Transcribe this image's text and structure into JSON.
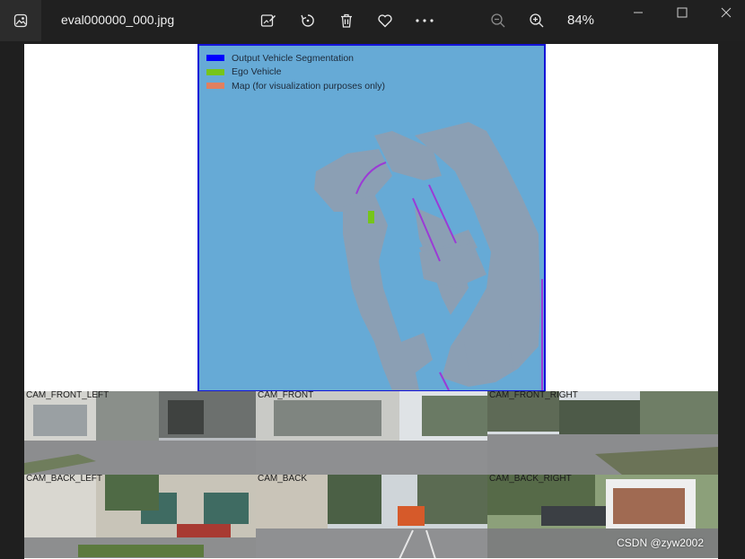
{
  "window": {
    "filename": "eval000000_000.jpg",
    "zoom_level": "84%"
  },
  "toolbar": {
    "icons": [
      "edit-image-icon",
      "rotate-icon",
      "delete-icon",
      "favorite-icon",
      "more-icon",
      "zoom-out-icon",
      "zoom-in-icon"
    ]
  },
  "bev": {
    "legend": [
      {
        "label": "Output Vehicle Segmentation",
        "color": "#0000ff"
      },
      {
        "label": "Ego Vehicle",
        "color": "#76c51a"
      },
      {
        "label": "Map (for visualization purposes only)",
        "color": "#e08060"
      }
    ],
    "colors": {
      "background": "#66aad6",
      "map": "#8d9fb3",
      "border": "#1414d8",
      "lane_line": "#9b3bd6"
    }
  },
  "cameras": {
    "labels": [
      "CAM_FRONT_LEFT",
      "CAM_FRONT",
      "CAM_FRONT_RIGHT",
      "CAM_BACK_LEFT",
      "CAM_BACK",
      "CAM_BACK_RIGHT"
    ]
  },
  "watermark": "CSDN @zyw2002"
}
